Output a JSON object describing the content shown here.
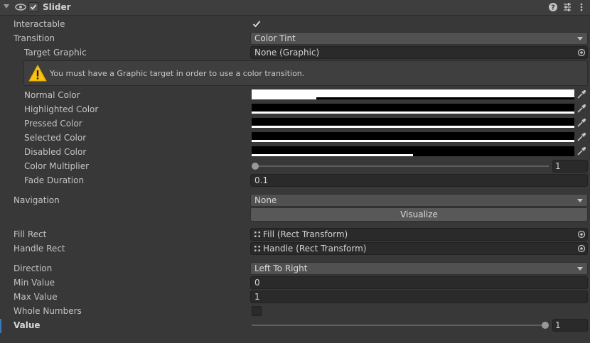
{
  "header": {
    "title": "Slider",
    "enabled": true
  },
  "labels": {
    "interactable": "Interactable",
    "transition": "Transition",
    "target_graphic": "Target Graphic",
    "normal_color": "Normal Color",
    "highlighted_color": "Highlighted Color",
    "pressed_color": "Pressed Color",
    "selected_color": "Selected Color",
    "disabled_color": "Disabled Color",
    "color_multiplier": "Color Multiplier",
    "fade_duration": "Fade Duration",
    "navigation": "Navigation",
    "fill_rect": "Fill Rect",
    "handle_rect": "Handle Rect",
    "direction": "Direction",
    "min_value": "Min Value",
    "max_value": "Max Value",
    "whole_numbers": "Whole Numbers",
    "value": "Value"
  },
  "values": {
    "interactable": true,
    "transition": "Color Tint",
    "target_graphic": "None (Graphic)",
    "helpbox_message": "You must have a Graphic target in order to use a color transition.",
    "color_multiplier": "1",
    "color_multiplier_fraction": 0.0,
    "fade_duration": "0.1",
    "navigation": "None",
    "visualize_button": "Visualize",
    "fill_rect": "Fill (Rect Transform)",
    "handle_rect": "Handle (Rect Transform)",
    "direction": "Left To Right",
    "min_value": "0",
    "max_value": "1",
    "whole_numbers": false,
    "value": "1",
    "value_fraction": 1.0
  },
  "colors": {
    "normal": {
      "rgb": "#ffffff",
      "alpha": 0.2
    },
    "highlighted": {
      "rgb": "#000000",
      "alpha": 1.0
    },
    "pressed": {
      "rgb": "#000000",
      "alpha": 1.0
    },
    "selected": {
      "rgb": "#000000",
      "alpha": 1.0
    },
    "disabled": {
      "rgb": "#000000",
      "alpha": 0.5
    }
  },
  "icons": {
    "foldout": "foldout-arrow-icon",
    "component": "eye-link-icon",
    "help": "question-icon",
    "presets": "sliders-icon",
    "menu": "kebab-menu-icon",
    "warning": "warning-icon",
    "object_picker": "target-circle-icon",
    "eyedropper": "eyedropper-icon",
    "rect_transform": "rect-transform-icon"
  }
}
